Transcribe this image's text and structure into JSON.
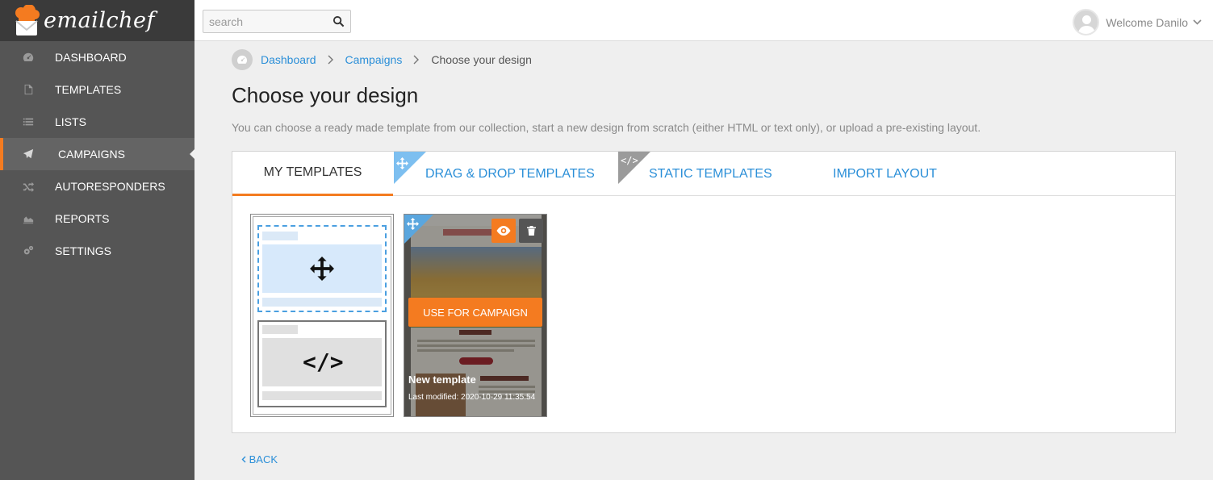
{
  "brand": {
    "name": "emailchef"
  },
  "sidebar": {
    "items": [
      {
        "label": "DASHBOARD",
        "icon": "dashboard-icon"
      },
      {
        "label": "TEMPLATES",
        "icon": "document-icon"
      },
      {
        "label": "LISTS",
        "icon": "list-icon"
      },
      {
        "label": "CAMPAIGNS",
        "icon": "paper-plane-icon",
        "active": true
      },
      {
        "label": "AUTORESPONDERS",
        "icon": "shuffle-icon"
      },
      {
        "label": "REPORTS",
        "icon": "area-chart-icon"
      },
      {
        "label": "SETTINGS",
        "icon": "gears-icon"
      }
    ]
  },
  "header": {
    "search_placeholder": "search",
    "welcome": "Welcome Danilo"
  },
  "breadcrumb": {
    "items": [
      "Dashboard",
      "Campaigns"
    ],
    "current": "Choose your design"
  },
  "page": {
    "title": "Choose your design",
    "description": "You can choose a ready made template from our collection, start a new design from scratch (either HTML or text only), or upload a pre-existing layout."
  },
  "tabs": [
    {
      "label": "MY TEMPLATES",
      "active": true
    },
    {
      "label": "DRAG & DROP TEMPLATES"
    },
    {
      "label": "STATIC TEMPLATES"
    },
    {
      "label": "IMPORT LAYOUT"
    }
  ],
  "template_card": {
    "use_label": "USE FOR CAMPAIGN",
    "name": "New template",
    "modified": "Last modified: 2020-10-29 11:35:54"
  },
  "back_label": "BACK",
  "colors": {
    "accent": "#f47b20",
    "link": "#2b8fd8",
    "sidebar": "#555555"
  }
}
